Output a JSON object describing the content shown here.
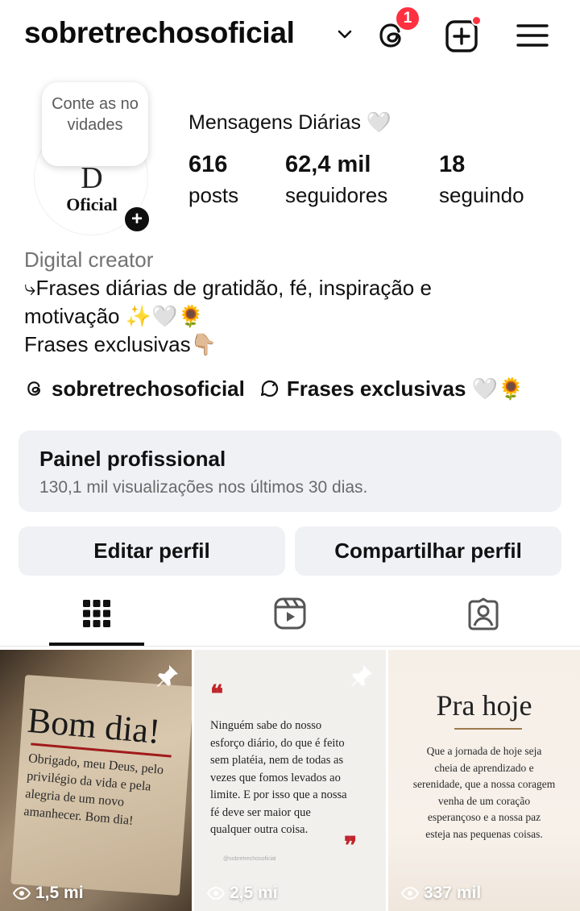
{
  "header": {
    "username": "sobretrechosoficial",
    "threads_badge": "1",
    "icons": [
      "chevron-down-icon",
      "threads-icon",
      "create-plus-icon",
      "hamburger-menu-icon"
    ]
  },
  "profile": {
    "note": "Conte as novidades",
    "avatar_mark": "D",
    "avatar_text": "Oficial",
    "full_name": "Mensagens Diárias 🤍",
    "stats": [
      {
        "value": "616",
        "label": "posts"
      },
      {
        "value": "62,4 mil",
        "label": "seguidores"
      },
      {
        "value": "18",
        "label": "seguindo"
      }
    ],
    "category": "Digital creator",
    "bio": "⤷Frases diárias de gratidão, fé, inspiração e\nmotivação ✨🤍🌻\nFrases exclusivas👇🏼",
    "links": [
      {
        "icon": "threads-icon",
        "text": "sobretrechosoficial"
      },
      {
        "icon": "broadcast-channel-icon",
        "text": "Frases exclusivas 🤍🌻"
      }
    ]
  },
  "dashboard": {
    "title": "Painel profissional",
    "subtitle": "130,1 mil visualizações nos últimos 30 dias."
  },
  "actions": {
    "edit": "Editar perfil",
    "share": "Compartilhar perfil"
  },
  "tabs": [
    {
      "icon": "grid-icon",
      "active": true
    },
    {
      "icon": "reels-icon",
      "active": false
    },
    {
      "icon": "tagged-icon",
      "active": false
    }
  ],
  "posts": [
    {
      "pinned": true,
      "title": "Bom dia!",
      "body": "Obrigado, meu Deus, pelo privilégio da vida e pela alegria de um novo amanhecer. Bom dia!",
      "views": "1,5 mi"
    },
    {
      "pinned": true,
      "open_quote": "❝",
      "body": "Ninguém sabe do nosso esforço diário, do que é feito sem plateia, nem de todas as vezes que fomos levados ao limite. E por isso que a nossa fé deve ser maior que qualquer outra coisa.",
      "body_lines": [
        "Ninguém sabe do nosso",
        "esforço diário, do que é feito",
        "sem platéia, nem de todas as",
        "vezes que fomos levados ao",
        "limite. E por isso que a nossa",
        "fé deve ser maior que",
        "qualquer outra coisa."
      ],
      "close_quote": "❞",
      "handle": "@sobretrechosoficial",
      "views": "2,5 mi"
    },
    {
      "pinned": false,
      "title": "Pra hoje",
      "body_lines": [
        "Que a jornada de hoje seja",
        "cheia de aprendizado e",
        "serenidade, que a nossa coragem",
        "venha de um coração",
        "esperançoso e a nossa paz",
        "esteja nas pequenas coisas."
      ],
      "views": "337 mil"
    }
  ]
}
